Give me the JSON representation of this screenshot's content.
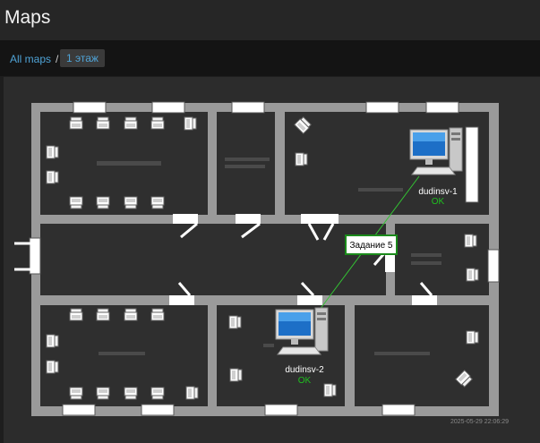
{
  "header": {
    "title": "Maps"
  },
  "breadcrumb": {
    "root": "All maps",
    "separator": "/",
    "current": "1 этаж"
  },
  "map": {
    "timestamp": "2025-05-29 22:06:29",
    "task_label": "Задание 5",
    "devices": [
      {
        "name": "dudinsv-1",
        "status": "OK"
      },
      {
        "name": "dudinsv-2",
        "status": "OK"
      }
    ],
    "colors": {
      "wall": "#9a9a9a",
      "floor": "#2f2f2f",
      "ok": "#1fbf1f",
      "link": "#33c433"
    }
  }
}
